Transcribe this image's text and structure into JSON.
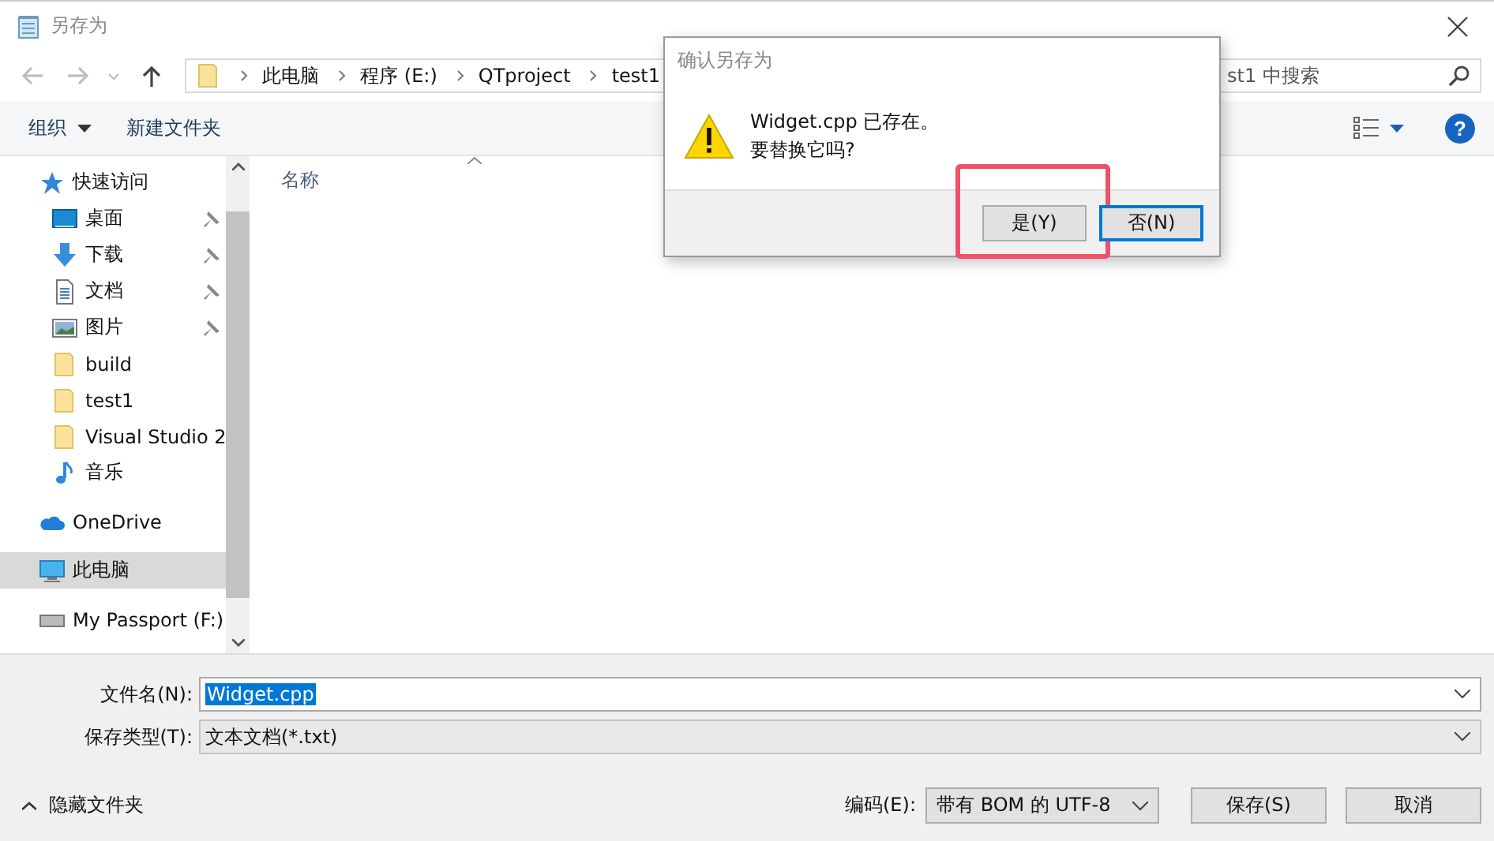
{
  "window": {
    "title": "另存为"
  },
  "nav": {
    "breadcrumb": [
      "此电脑",
      "程序 (E:)",
      "QTproject",
      "test1"
    ],
    "search": {
      "placeholder": "st1 中搜索"
    }
  },
  "toolbar": {
    "organize": "组织",
    "new_folder": "新建文件夹",
    "help": "?"
  },
  "sidebar": {
    "items": [
      {
        "label": "快速访问",
        "kind": "star",
        "selected": false,
        "children": [
          {
            "label": "桌面",
            "kind": "desktop",
            "pinned": true,
            "selected": false
          },
          {
            "label": "下载",
            "kind": "download",
            "pinned": true,
            "selected": false
          },
          {
            "label": "文档",
            "kind": "document",
            "pinned": true,
            "selected": false
          },
          {
            "label": "图片",
            "kind": "picture",
            "pinned": true,
            "selected": false
          },
          {
            "label": "build",
            "kind": "folder",
            "pinned": false,
            "selected": false
          },
          {
            "label": "test1",
            "kind": "folder",
            "pinned": false,
            "selected": false
          },
          {
            "label": "Visual Studio 2",
            "kind": "folder",
            "pinned": false,
            "selected": false
          },
          {
            "label": "音乐",
            "kind": "music",
            "pinned": false,
            "selected": false
          }
        ]
      },
      {
        "label": "OneDrive",
        "kind": "cloud",
        "selected": false
      },
      {
        "label": "此电脑",
        "kind": "computer",
        "selected": true
      },
      {
        "label": "My Passport (F:)",
        "kind": "drive",
        "selected": false
      }
    ]
  },
  "file_list": {
    "column": "名称"
  },
  "file_name": {
    "label": "文件名(N):",
    "value": "Widget.cpp"
  },
  "file_type": {
    "label": "保存类型(T):",
    "value": "文本文档(*.txt)"
  },
  "hide_folders": "隐藏文件夹",
  "encoding": {
    "label": "编码(E):",
    "value": "带有 BOM 的 UTF-8"
  },
  "buttons": [
    "保存(S)",
    "取消"
  ],
  "dialog": {
    "title": "确认另存为",
    "message": [
      "Widget.cpp 已存在。",
      "要替换它吗?"
    ],
    "buttons": [
      {
        "label": "是(Y)",
        "default": false,
        "highlighted": true
      },
      {
        "label": "否(N)",
        "default": true,
        "highlighted": false
      }
    ]
  }
}
